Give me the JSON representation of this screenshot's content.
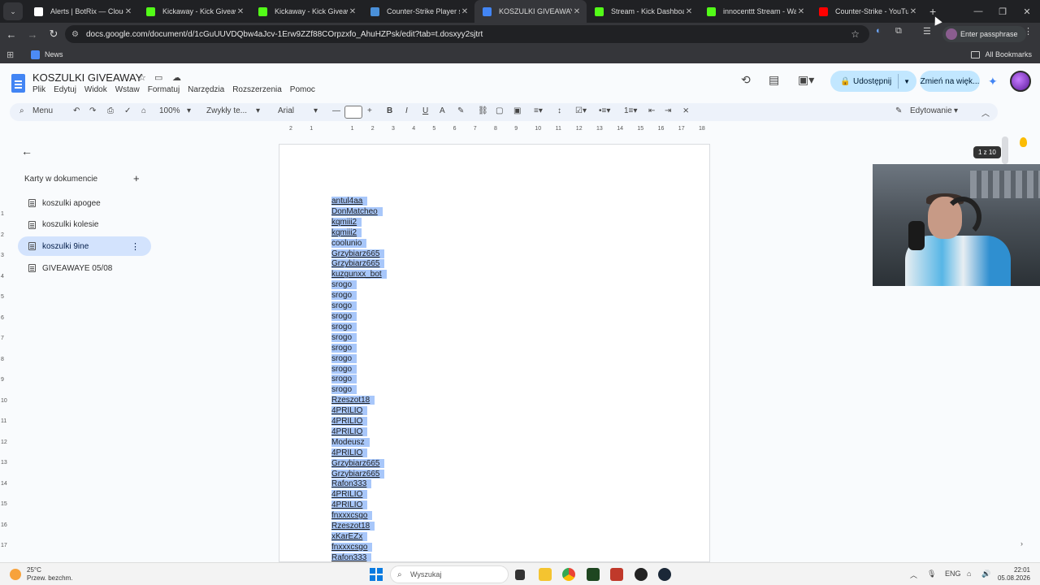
{
  "browser": {
    "tabs": [
      {
        "label": "Alerts | BotRix — Cloud S",
        "color": "#ffffff"
      },
      {
        "label": "Kickaway - Kick Giveaway",
        "color": "#53fc18"
      },
      {
        "label": "Kickaway - Kick Giveaway",
        "color": "#53fc18"
      },
      {
        "label": "Counter-Strike Player stat",
        "color": "#4a90d9"
      },
      {
        "label": "KOSZULKI GIVEAWAY - Do",
        "color": "#4285f4"
      },
      {
        "label": "Stream - Kick Dashboard",
        "color": "#53fc18"
      },
      {
        "label": "innocenttt Stream - Watc",
        "color": "#53fc18"
      },
      {
        "label": "Counter-Strike - YouTube",
        "color": "#ff0000"
      }
    ],
    "url": "docs.google.com/document/d/1cGuUUVDQbw4aJcv-1Erw9ZZf88COrpzxfo_AhuHZPsk/edit?tab=t.dosxyy2sjtrt",
    "passphrase_label": "Enter passphrase",
    "bookmarks": {
      "news": "News",
      "all": "All Bookmarks"
    }
  },
  "docs": {
    "title": "KOSZULKI GIVEAWAY",
    "menus": [
      "Plik",
      "Edytuj",
      "Widok",
      "Wstaw",
      "Formatuj",
      "Narzędzia",
      "Rozszerzenia",
      "Pomoc"
    ],
    "share_label": "Udostępnij",
    "switch_label": "Zmień na więk...",
    "toolbar": {
      "menu": "Menu",
      "zoom": "100%",
      "style": "Zwykły te...",
      "font": "Arial",
      "mode": "Edytowanie"
    },
    "page_count": "1 z 10"
  },
  "sidebar": {
    "header": "Karty w dokumencie",
    "items": [
      {
        "label": "koszulki apogee"
      },
      {
        "label": "koszulki kolesie"
      },
      {
        "label": "koszulki 9ine"
      },
      {
        "label": "GIVEAWAYE 05/08"
      }
    ]
  },
  "document_lines": [
    "antul4aa",
    "DonMatcheo",
    "kqmiii2",
    "kqmiii2",
    "coolunio",
    "Grzybiarz665",
    "Grzybiarz665",
    "kuzgunxx_bot",
    "srogo",
    "srogo",
    "srogo",
    "srogo",
    "srogo",
    "srogo",
    "srogo",
    "srogo",
    "srogo",
    "srogo",
    "srogo",
    "Rzeszot18",
    "4PRILIO",
    "4PRILIO",
    "4PRILIO",
    "Modeusz",
    "4PRILIO",
    "Grzybiarz665",
    "Grzybiarz665",
    "Rafon333",
    "4PRILIO",
    "4PRILIO",
    "fnxxxcsgo",
    "Rzeszot18",
    "xKarEZx",
    "fnxxxcsgo",
    "Rafon333"
  ],
  "taskbar": {
    "weather_temp": "25°C",
    "weather_desc": "Przew. bezchm.",
    "search_placeholder": "Wyszukaj",
    "lang": "ENG",
    "time": "22:01",
    "date": "05.08.2026"
  }
}
